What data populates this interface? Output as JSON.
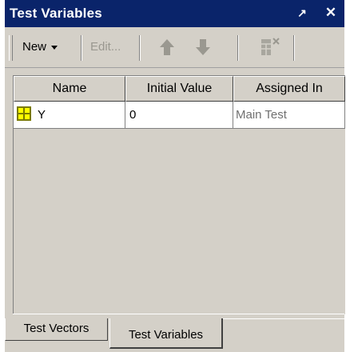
{
  "window": {
    "title": "Test Variables",
    "pin_glyph": "↗",
    "close_glyph": "✕"
  },
  "toolbar": {
    "new_label": "New",
    "edit_label": "Edit..."
  },
  "grid": {
    "columns": [
      "Name",
      "Initial Value",
      "Assigned In"
    ],
    "rows": [
      {
        "name": "Y",
        "initial_value": "0",
        "assigned_in": "Main Test",
        "icon": "variable-grid-icon"
      }
    ]
  },
  "tabs": [
    {
      "label": "Test Vectors",
      "active": false
    },
    {
      "label": "Test Variables",
      "active": true
    }
  ],
  "colors": {
    "titlebar": "#0a246a",
    "panel": "#d4d0c8",
    "arrow_icon": "#9a9890",
    "variable_icon_fill": "#ffff00",
    "variable_icon_stroke": "#7a7a00"
  }
}
